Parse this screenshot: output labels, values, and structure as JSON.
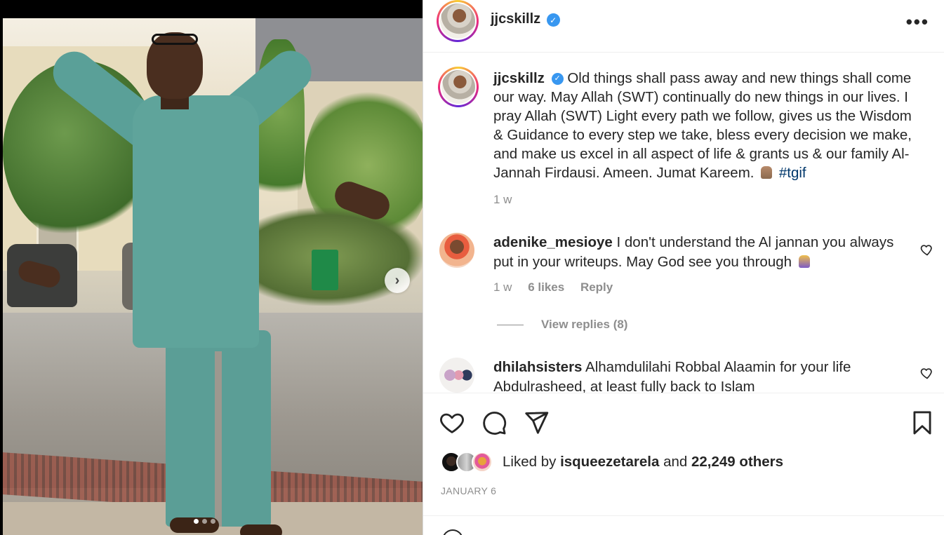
{
  "post": {
    "author": "jjcskillz",
    "verified": true,
    "more_label": "•••",
    "carousel_next": "›",
    "carousel_dots": 3,
    "carousel_active_dot": 1
  },
  "caption": {
    "username": "jjcskillz",
    "text": "Old things shall pass away and new things shall come our way. May Allah (SWT) continually do new things in our lives. I pray Allah (SWT) Light every path we follow, gives us the Wisdom & Guidance to every step we take, bless every decision we make, and make us excel in all aspect of life & grants us & our family Al-Jannah Firdausi. Ameen. Jumat Kareem.",
    "hashtag": "#tgif",
    "time": "1 w"
  },
  "comments": [
    {
      "username": "adenike_mesioye",
      "text": "I don't understand the Al jannan you always put in your writeups. May God see you through",
      "time": "1 w",
      "likes": "6 likes",
      "reply_label": "Reply",
      "view_replies": "View replies (8)"
    },
    {
      "username": "dhilahsisters",
      "text": "Alhamdulilahi Robbal Alaamin for your life Abdulrasheed, at least fully back to Islam"
    }
  ],
  "likes": {
    "prefix": "Liked by",
    "user": "isqueezetarela",
    "middle": "and",
    "others": "22,249 others"
  },
  "date": "JANUARY 6",
  "icons": {
    "like": "heart-icon",
    "comment": "comment-icon",
    "share": "send-icon",
    "save": "bookmark-icon",
    "more": "more-icon",
    "next": "chevron-right-icon"
  },
  "colors": {
    "accent_link": "#00376b",
    "verified": "#3897f0",
    "muted": "#8e8e8e",
    "text": "#262626"
  }
}
